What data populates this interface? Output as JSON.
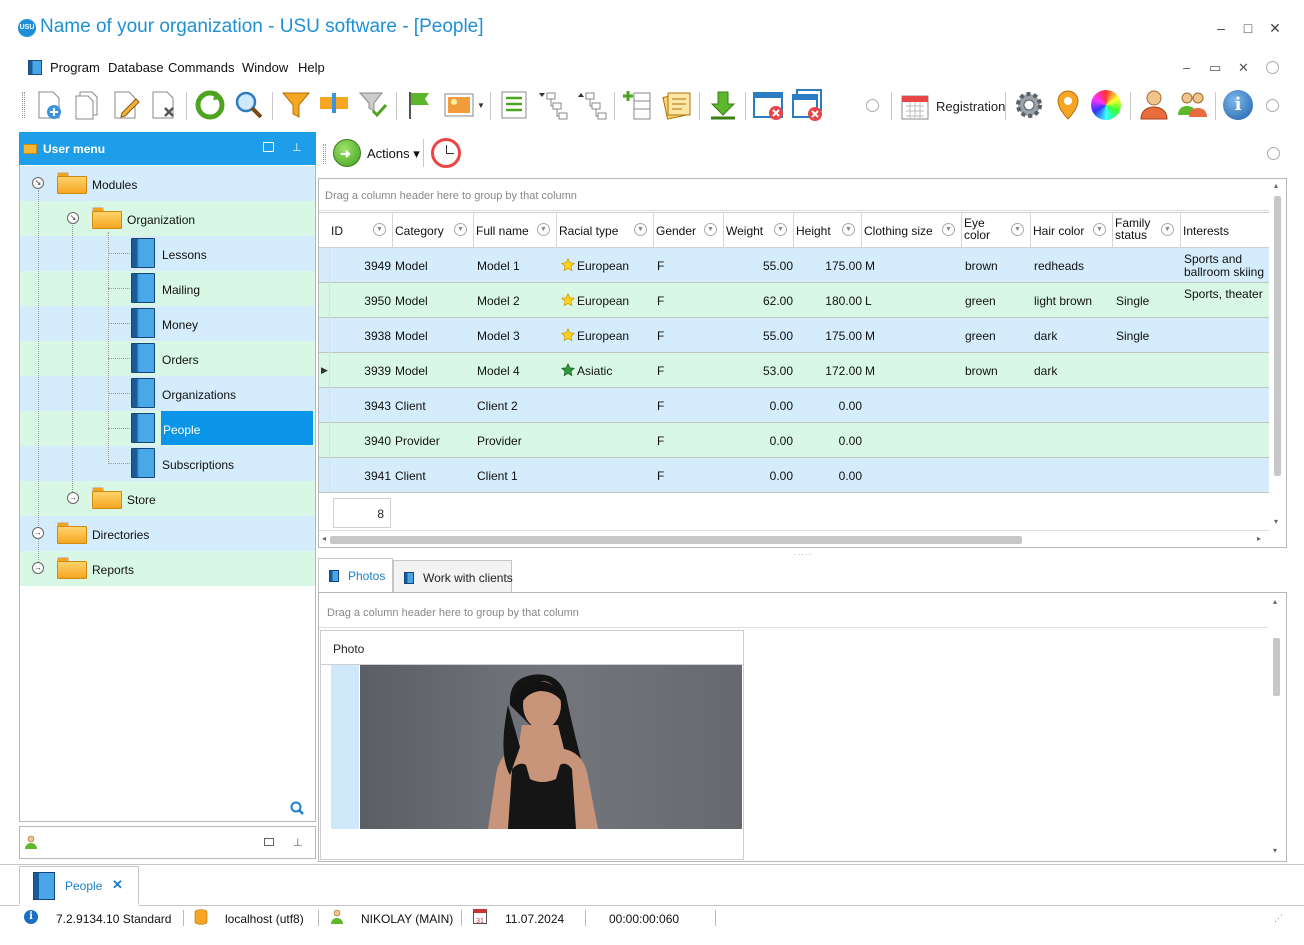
{
  "window": {
    "logo_text": "USU",
    "title": "Name of your organization - USU software - [People]",
    "minimize": "–",
    "maximize": "□",
    "close": "✕"
  },
  "menu": {
    "items": [
      "Program",
      "Database",
      "Commands",
      "Window",
      "Help"
    ],
    "mdi_buttons": [
      "–",
      "▭",
      "✕"
    ]
  },
  "toolbar": {
    "registration_label": "Registration",
    "icons": [
      "add-record-icon",
      "copy-record-icon",
      "edit-record-icon",
      "delete-record-icon",
      "refresh-icon",
      "search-icon",
      "filter-icon",
      "filter-settings-icon",
      "clear-filter-icon",
      "flag-icon",
      "image-icon",
      "group-icon",
      "tree-expand-icon",
      "tree-collapse-icon",
      "add-column-icon",
      "notes-icon",
      "download-icon",
      "close-window-icon",
      "close-all-windows-icon",
      "calendar-icon",
      "settings-icon",
      "location-icon",
      "color-wheel-icon",
      "user-icon",
      "users-icon",
      "info-icon"
    ]
  },
  "left_menu": {
    "title": "User menu",
    "items": [
      {
        "label": "Modules"
      },
      {
        "label": "Organization"
      },
      {
        "label": "Lessons"
      },
      {
        "label": "Mailing"
      },
      {
        "label": "Money"
      },
      {
        "label": "Orders"
      },
      {
        "label": "Organizations"
      },
      {
        "label": "People"
      },
      {
        "label": "Subscriptions"
      },
      {
        "label": "Store"
      },
      {
        "label": "Directories"
      },
      {
        "label": "Reports"
      }
    ]
  },
  "actions": {
    "label": "Actions ▾"
  },
  "grid": {
    "group_panel_text": "Drag a column header here to group by that column",
    "columns": [
      "ID",
      "Category",
      "Full name",
      "Racial type",
      "Gender",
      "Weight",
      "Height",
      "Clothing size",
      "Eye color",
      "Hair color",
      "Family status",
      "Interests"
    ],
    "rows": [
      {
        "id": "3949",
        "category": "Model",
        "full_name": "Model 1",
        "racial_type": "European",
        "gender": "F",
        "weight": "55.00",
        "height": "175.00",
        "clothing_size": "M",
        "eye_color": "brown",
        "hair_color": "redheads",
        "family_status": "",
        "interests": "Sports and ballroom skiing",
        "star": "gold"
      },
      {
        "id": "3950",
        "category": "Model",
        "full_name": "Model 2",
        "racial_type": "European",
        "gender": "F",
        "weight": "62.00",
        "height": "180.00",
        "clothing_size": "L",
        "eye_color": "green",
        "hair_color": "light brown",
        "family_status": "Single",
        "interests": "Sports, theater",
        "star": "gold"
      },
      {
        "id": "3938",
        "category": "Model",
        "full_name": "Model 3",
        "racial_type": "European",
        "gender": "F",
        "weight": "55.00",
        "height": "175.00",
        "clothing_size": "M",
        "eye_color": "green",
        "hair_color": "dark",
        "family_status": "Single",
        "interests": "",
        "star": "gold"
      },
      {
        "id": "3939",
        "category": "Model",
        "full_name": "Model 4",
        "racial_type": "Asiatic",
        "gender": "F",
        "weight": "53.00",
        "height": "172.00",
        "clothing_size": "M",
        "eye_color": "brown",
        "hair_color": "dark",
        "family_status": "",
        "interests": "",
        "star": "green"
      },
      {
        "id": "3943",
        "category": "Client",
        "full_name": "Client 2",
        "racial_type": "",
        "gender": "F",
        "weight": "0.00",
        "height": "0.00",
        "clothing_size": "",
        "eye_color": "",
        "hair_color": "",
        "family_status": "",
        "interests": "",
        "star": ""
      },
      {
        "id": "3940",
        "category": "Provider",
        "full_name": "Provider",
        "racial_type": "",
        "gender": "F",
        "weight": "0.00",
        "height": "0.00",
        "clothing_size": "",
        "eye_color": "",
        "hair_color": "",
        "family_status": "",
        "interests": "",
        "star": ""
      },
      {
        "id": "3941",
        "category": "Client",
        "full_name": "Client 1",
        "racial_type": "",
        "gender": "F",
        "weight": "0.00",
        "height": "0.00",
        "clothing_size": "",
        "eye_color": "",
        "hair_color": "",
        "family_status": "",
        "interests": "",
        "star": ""
      }
    ],
    "record_count": "8"
  },
  "detail_tabs": {
    "tabs": [
      "Photos",
      "Work with clients"
    ],
    "group_panel_text": "Drag a column header here to group by that column",
    "photo_column": "Photo"
  },
  "doc_tab": {
    "label": "People",
    "close": "✕"
  },
  "status": {
    "version": "7.2.9134.10 Standard",
    "server": "localhost (utf8)",
    "user": "NIKOLAY (MAIN)",
    "date": "11.07.2024",
    "timer": "00:00:00:060",
    "calendar_day": "31"
  },
  "colors": {
    "accent": "#1e9ee8",
    "row_blue": "#d4ecfb",
    "row_green": "#d8f8e5",
    "selected": "#0a95e8"
  }
}
